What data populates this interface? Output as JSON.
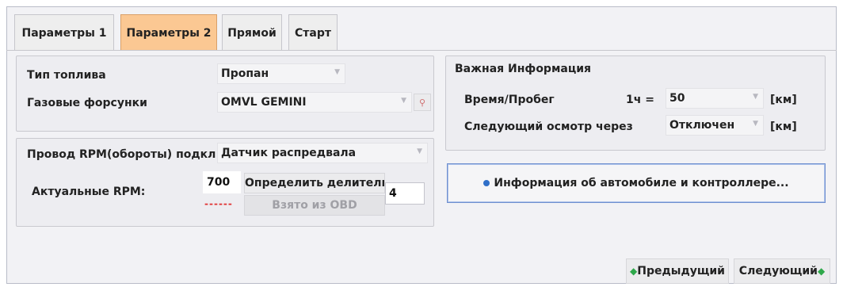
{
  "tabs": [
    {
      "label": "Параметры 1",
      "active": false
    },
    {
      "label": "Параметры 2",
      "active": true
    },
    {
      "label": "Прямой",
      "active": false
    },
    {
      "label": "Старт",
      "active": false
    }
  ],
  "fuel": {
    "type_label": "Тип топлива",
    "type_value": "Пропан",
    "injectors_label": "Газовые форсунки",
    "injectors_value": "OMVL GEMINI"
  },
  "rpm": {
    "wire_label": "Провод RPM(обороты) подкл",
    "wire_value": "Датчик распредвала",
    "actual_label": "Актуальные RPM:",
    "actual_value": "700",
    "actual_indicator": "------",
    "determine_label": "Определить делитель",
    "divider_value": "4",
    "obd_label": "Взято из OBD"
  },
  "important": {
    "title": "Важная Информация",
    "time_label": "Время/Пробег",
    "per_hour": "1ч =",
    "time_value": "50",
    "unit1": "[км]",
    "next_label": "Следующий осмотр через",
    "next_value": "Отключен",
    "unit2": "[км]"
  },
  "info_button": "Информация об автомобиле и контроллере...",
  "nav": {
    "prev": "Предыдущий",
    "next": "Следующий"
  },
  "colors": {
    "active_tab": "#fbc893",
    "accent_blue": "#2f6fc8",
    "arrow_green": "#2ea84a",
    "indicator_red": "#e03030"
  }
}
